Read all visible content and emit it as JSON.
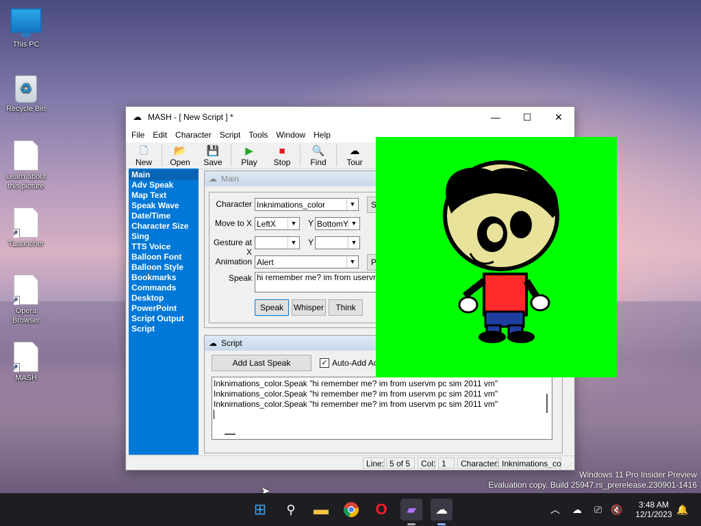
{
  "desktop": {
    "icons": [
      {
        "label": "This PC"
      },
      {
        "label": "Recycle Bin"
      },
      {
        "label": "Learn about\nthis picture"
      },
      {
        "label": "TLauncher"
      },
      {
        "label": "Opera\nBrowser"
      },
      {
        "label": "MASH"
      }
    ]
  },
  "window": {
    "title": "MASH - [ New Script ] *",
    "menu": [
      "File",
      "Edit",
      "Character",
      "Script",
      "Tools",
      "Window",
      "Help"
    ],
    "toolbar": [
      "New",
      "Open",
      "Save",
      "Play",
      "Stop",
      "Find",
      "Tour"
    ],
    "nav": [
      "Main",
      "Adv Speak",
      "Map Text",
      "Speak Wave",
      "Date/Time",
      "Character Size",
      "Sing",
      "TTS Voice",
      "Balloon Font",
      "Balloon Style",
      "Bookmarks",
      "Commands",
      "Desktop",
      "PowerPoint",
      "Script Output",
      "Script"
    ],
    "main_panel": {
      "title": "Main",
      "character_label": "Character",
      "character_value": "Inknimations_color",
      "moveto_label": "Move to X",
      "moveto_x": "LeftX",
      "y_label": "Y",
      "moveto_y": "BottomY",
      "gesture_label": "Gesture at X",
      "gesture_x": "",
      "gesture_y": "",
      "animation_label": "Animation",
      "animation_value": "Alert",
      "speak_label": "Speak",
      "speak_value": "hi remember me? im from uservm pc s",
      "btn_speak": "Speak",
      "btn_whisper": "Whisper",
      "btn_think": "Think",
      "side_btn_s": "S",
      "side_btn_p": "P"
    },
    "script_panel": {
      "title": "Script",
      "add_last": "Add Last Speak",
      "auto_add": "Auto-Add Acti",
      "lines": [
        "Inknimations_color.Speak \"hi remember me? im from uservm pc sim 2011 vm\"",
        "Inknimations_color.Speak \"hi remember me? im from uservm pc sim 2011 vm\"",
        "Inknimations_color.Speak \"hi remember me? im from uservm pc sim 2011 vm\""
      ]
    },
    "status": {
      "line_label": "Line:",
      "line_value": "5 of 5",
      "col_label": "Col:",
      "col_value": "1",
      "char_label": "Character:",
      "char_value": "Inknimations_color"
    }
  },
  "watermark": {
    "line1": "Windows 11 Pro Insider Preview",
    "line2": "Evaluation copy. Build 25947.rs_prerelease.230901-1416"
  },
  "taskbar": {
    "time": "3:48 AM",
    "date": "12/1/2023",
    "icons": [
      "windows-start-icon",
      "search-icon",
      "file-explorer-icon",
      "chrome-icon",
      "opera-icon",
      "video-editor-icon",
      "mash-icon"
    ]
  },
  "colors": {
    "green_screen": "#00ff00",
    "nav_blue": "#0078d7"
  }
}
